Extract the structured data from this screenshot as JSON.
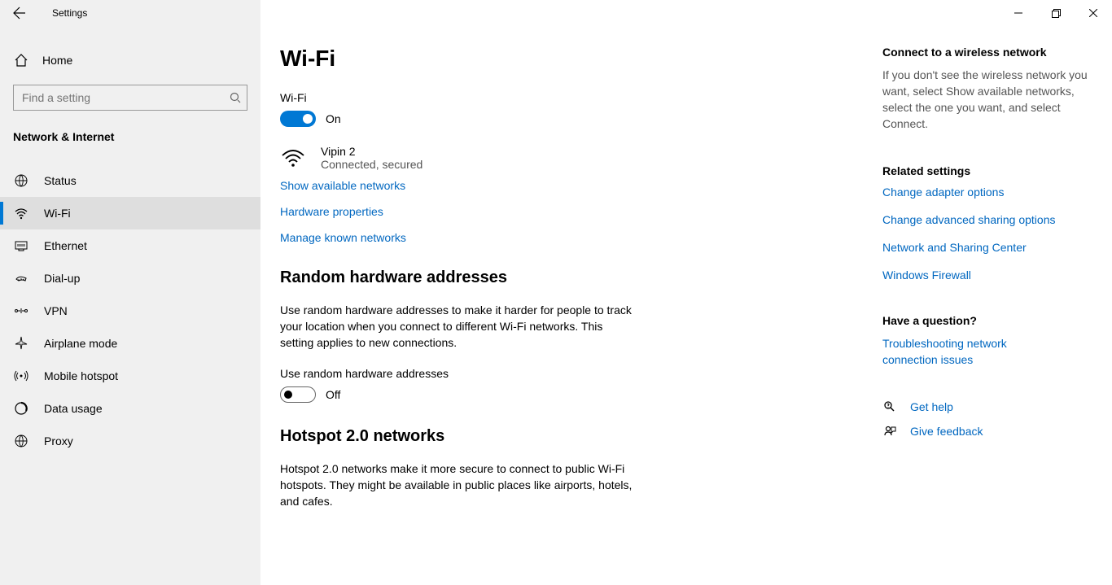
{
  "window": {
    "title": "Settings"
  },
  "sidebar": {
    "home_label": "Home",
    "search_placeholder": "Find a setting",
    "category": "Network & Internet",
    "items": [
      {
        "label": "Status"
      },
      {
        "label": "Wi-Fi"
      },
      {
        "label": "Ethernet"
      },
      {
        "label": "Dial-up"
      },
      {
        "label": "VPN"
      },
      {
        "label": "Airplane mode"
      },
      {
        "label": "Mobile hotspot"
      },
      {
        "label": "Data usage"
      },
      {
        "label": "Proxy"
      }
    ]
  },
  "main": {
    "title": "Wi-Fi",
    "wifi": {
      "label": "Wi-Fi",
      "state_label": "On",
      "network_name": "Vipin 2",
      "network_status": "Connected, secured"
    },
    "links": {
      "show_networks": "Show available networks",
      "hardware_props": "Hardware properties",
      "manage_known": "Manage known networks"
    },
    "random_hw": {
      "heading": "Random hardware addresses",
      "description": "Use random hardware addresses to make it harder for people to track your location when you connect to different Wi-Fi networks. This setting applies to new connections.",
      "toggle_label": "Use random hardware addresses",
      "state_label": "Off"
    },
    "hotspot": {
      "heading": "Hotspot 2.0 networks",
      "description": "Hotspot 2.0 networks make it more secure to connect to public Wi-Fi hotspots. They might be available in public places like airports, hotels, and cafes."
    }
  },
  "right": {
    "connect": {
      "heading": "Connect to a wireless network",
      "text": "If you don't see the wireless network you want, select Show available networks, select the one you want, and select Connect."
    },
    "related": {
      "heading": "Related settings",
      "links": [
        "Change adapter options",
        "Change advanced sharing options",
        "Network and Sharing Center",
        "Windows Firewall"
      ]
    },
    "question": {
      "heading": "Have a question?",
      "link": "Troubleshooting network connection issues"
    },
    "help": "Get help",
    "feedback": "Give feedback"
  }
}
